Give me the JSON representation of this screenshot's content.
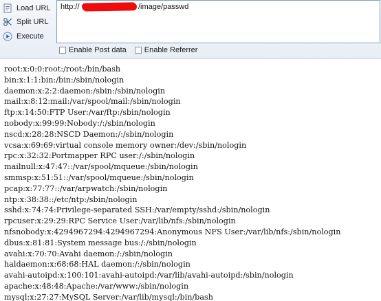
{
  "toolbar": {
    "load_url_label": "Load URL",
    "split_url_label": "Split URL",
    "execute_label": "Execute"
  },
  "url": {
    "prefix": "http://",
    "suffix": "/image/passwd"
  },
  "options": {
    "post_label": "Enable Post data",
    "referrer_label": "Enable Referrer"
  },
  "output_lines": [
    "root:x:0:0:root:/root:/bin/bash",
    "bin:x:1:1:bin:/bin:/sbin/nologin",
    "daemon:x:2:2:daemon:/sbin:/sbin/nologin",
    "mail:x:8:12:mail:/var/spool/mail:/sbin/nologin",
    "ftp:x:14:50:FTP User:/var/ftp:/sbin/nologin",
    "nobody:x:99:99:Nobody:/:/sbin/nologin",
    "nscd:x:28:28:NSCD Daemon:/:/sbin/nologin",
    "vcsa:x:69:69:virtual console memory owner:/dev:/sbin/nologin",
    "rpc:x:32:32:Portmapper RPC user:/:/sbin/nologin",
    "mailnull:x:47:47::/var/spool/mqueue:/sbin/nologin",
    "smmsp:x:51:51::/var/spool/mqueue:/sbin/nologin",
    "pcap:x:77:77::/var/arpwatch:/sbin/nologin",
    "ntp:x:38:38::/etc/ntp:/sbin/nologin",
    "sshd:x:74:74:Privilege-separated SSH:/var/empty/sshd:/sbin/nologin",
    "rpcuser:x:29:29:RPC Service User:/var/lib/nfs:/sbin/nologin",
    "nfsnobody:x:4294967294:4294967294:Anonymous NFS User:/var/lib/nfs:/sbin/nologin",
    "dbus:x:81:81:System message bus:/:/sbin/nologin",
    "avahi:x:70:70:Avahi daemon:/:/sbin/nologin",
    "haldaemon:x:68:68:HAL daemon:/:/sbin/nologin",
    "avahi-autoipd:x:100:101:avahi-autoipd:/var/lib/avahi-autoipd:/sbin/nologin",
    "apache:x:48:48:Apache:/var/www:/sbin/nologin",
    "mysql:x:27:27:MySQL Server:/var/lib/mysql:/bin/bash"
  ]
}
